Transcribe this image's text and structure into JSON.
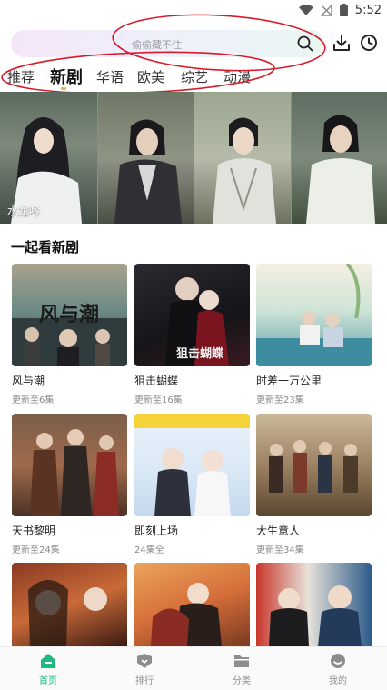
{
  "status_bar": {
    "time": "5:52"
  },
  "search": {
    "placeholder": "偷偷藏不住"
  },
  "tabs": [
    {
      "label": "推荐"
    },
    {
      "label": "新剧"
    },
    {
      "label": "华语"
    },
    {
      "label": "欧美"
    },
    {
      "label": "综艺"
    },
    {
      "label": "动漫"
    }
  ],
  "active_tab": "新剧",
  "banner": {
    "caption": "水龙吟"
  },
  "section": {
    "title": "一起看新剧"
  },
  "shows": [
    {
      "title": "风与潮",
      "update": "更新至6集",
      "poster_text": "风与潮"
    },
    {
      "title": "狙击蝴蝶",
      "update": "更新至16集",
      "poster_text": "狙击蝴蝶"
    },
    {
      "title": "时差一万公里",
      "update": "更新至23集",
      "poster_text": ""
    },
    {
      "title": "天书黎明",
      "update": "更新至24集",
      "poster_text": ""
    },
    {
      "title": "即刻上场",
      "update": "24集全",
      "poster_text": ""
    },
    {
      "title": "大生意人",
      "update": "更新至34集",
      "poster_text": ""
    },
    {
      "title": "",
      "update": "",
      "poster_text": ""
    },
    {
      "title": "",
      "update": "",
      "poster_text": ""
    },
    {
      "title": "",
      "update": "",
      "poster_text": ""
    }
  ],
  "bottom_nav": [
    {
      "label": "首页",
      "icon": "home-icon",
      "active": true
    },
    {
      "label": "排行",
      "icon": "rank-icon",
      "active": false
    },
    {
      "label": "分类",
      "icon": "folder-icon",
      "active": false
    },
    {
      "label": "我的",
      "icon": "profile-icon",
      "active": false
    }
  ],
  "colors": {
    "accent": "#1fb97d",
    "annotation": "#d81b2a",
    "tab_indicator": "#f2b12c"
  }
}
